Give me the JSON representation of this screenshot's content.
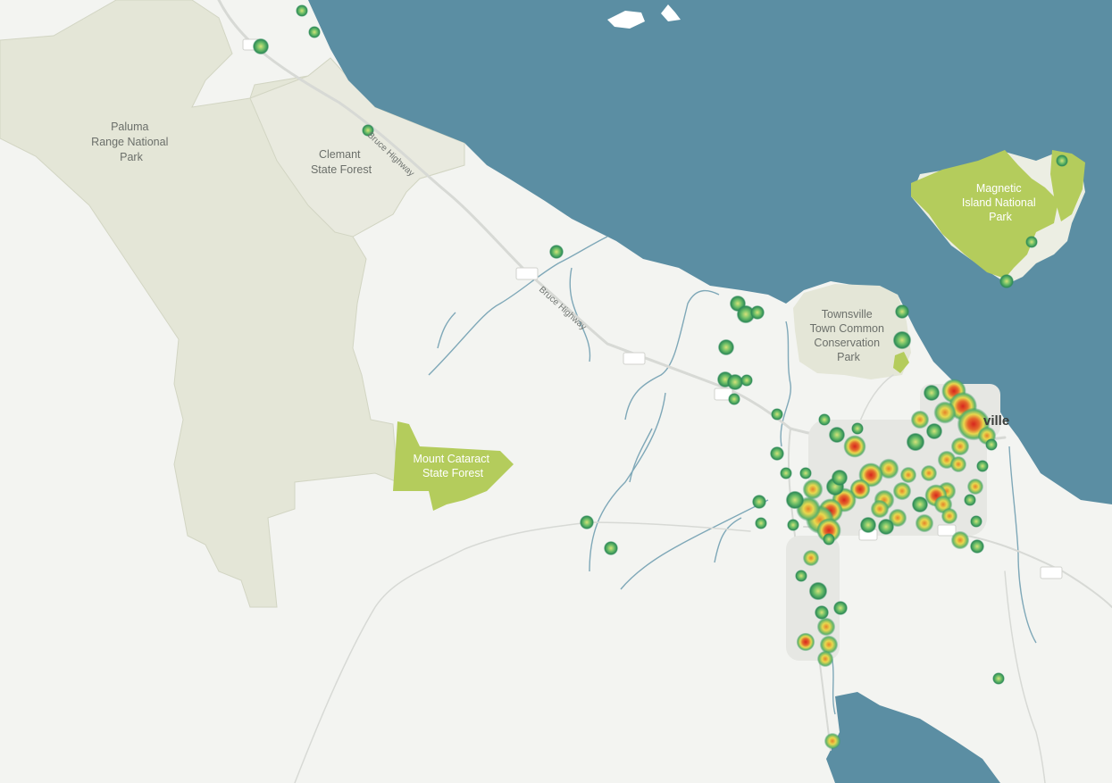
{
  "map": {
    "colors": {
      "water": "#5b8ea3",
      "land": "#f3f4f1",
      "park_light": "#e4e6d7",
      "park_green": "#b4cc5c",
      "road": "#d7d9d5",
      "river": "#7fa8b8"
    },
    "labels": {
      "paluma": [
        "Paluma",
        "Range National",
        "Park"
      ],
      "clemant": [
        "Clemant",
        "State Forest"
      ],
      "mount_cataract": [
        "Mount Cataract",
        "State Forest"
      ],
      "magnetic": [
        "Magnetic",
        "Island National",
        "Park"
      ],
      "town_common": [
        "Townsville",
        "Town Common",
        "Conservation",
        "Park"
      ],
      "city": "ville",
      "road_1": "Bruce Highway",
      "road_2": "Bruce Highway"
    },
    "heat_scale": {
      "low": "#2e8b57",
      "mid": "#e8d84e",
      "high": "#d7261e"
    }
  }
}
